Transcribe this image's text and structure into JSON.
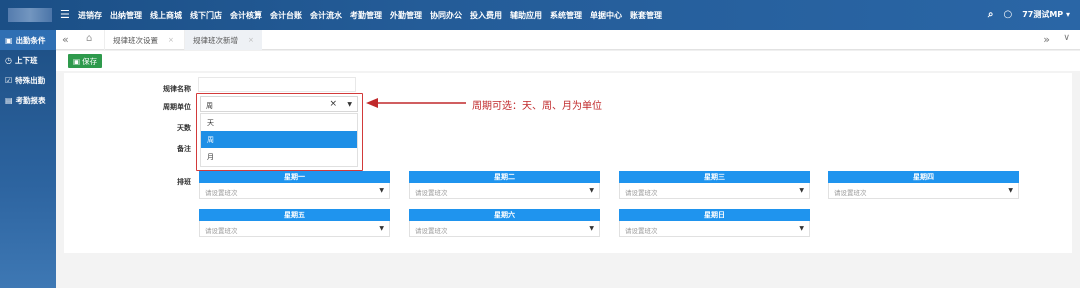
{
  "topbar": {
    "menu": [
      "进销存",
      "出纳管理",
      "线上商城",
      "线下门店",
      "会计核算",
      "会计台账",
      "会计流水",
      "考勤管理",
      "外勤管理",
      "协同办公",
      "投入费用",
      "辅助应用",
      "系统管理",
      "单据中心",
      "账套管理"
    ],
    "user": "77测试MP"
  },
  "sidebar": {
    "items": [
      {
        "label": "出勤条件",
        "icon": "calendar-icon"
      },
      {
        "label": "上下班",
        "icon": "clock-icon"
      },
      {
        "label": "特殊出勤",
        "icon": "check-icon"
      },
      {
        "label": "考勤报表",
        "icon": "report-icon"
      }
    ]
  },
  "tabs": [
    {
      "label": "规律班次设置"
    },
    {
      "label": "规律班次新增"
    }
  ],
  "toolbar": {
    "save_label": "保存"
  },
  "form": {
    "name_label": "规律名称",
    "unit_label": "周期单位",
    "days_label": "天数",
    "note_label": "备注",
    "schedule_label": "排班",
    "unit_value": "周",
    "unit_options": [
      "天",
      "周",
      "月"
    ],
    "selected_option": "周"
  },
  "annotation": {
    "text": "周期可选：天、周、月为单位",
    "color": "#c0292b"
  },
  "schedule": {
    "placeholder": "请设置班次",
    "days": [
      "星期一",
      "星期二",
      "星期三",
      "星期四",
      "星期五",
      "星期六",
      "星期日"
    ]
  },
  "colors": {
    "accent": "#1f94ee",
    "save": "#2e9a4c",
    "topbar": "#245c98"
  }
}
